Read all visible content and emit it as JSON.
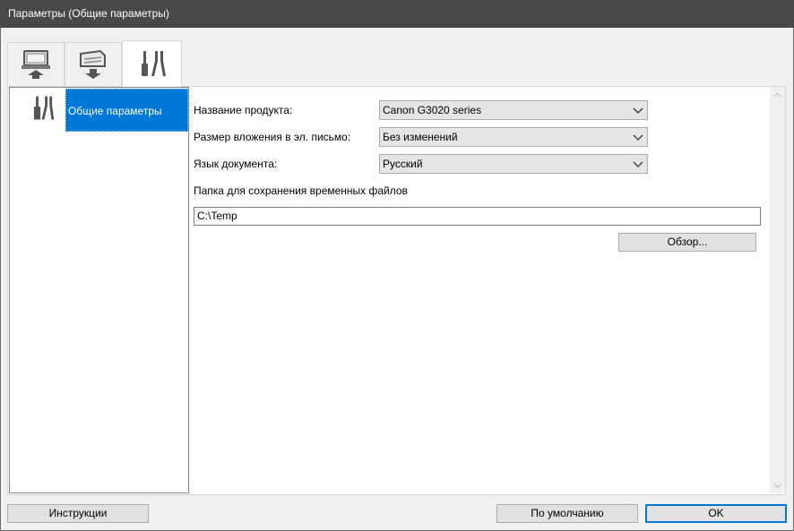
{
  "window": {
    "title": "Параметры (Общие параметры)"
  },
  "tabs": [
    {
      "icon": "computer-upload-icon",
      "active": false
    },
    {
      "icon": "scanner-download-icon",
      "active": false
    },
    {
      "icon": "tools-icon",
      "active": true
    }
  ],
  "nav": {
    "items": [
      {
        "icon": "tools-icon",
        "label": "Общие параметры",
        "selected": true
      }
    ]
  },
  "settings": {
    "product_name": {
      "label": "Название продукта:",
      "value": "Canon G3020 series"
    },
    "attachment_size": {
      "label": "Размер вложения в эл. письмо:",
      "value": "Без изменений"
    },
    "document_language": {
      "label": "Язык документа:",
      "value": "Русский"
    },
    "temp_folder": {
      "label": "Папка для сохранения временных файлов",
      "value": "C:\\Temp"
    },
    "browse_label": "Обзор..."
  },
  "footer": {
    "instructions_label": "Инструкции",
    "defaults_label": "По умолчанию",
    "ok_label": "OK"
  },
  "colors": {
    "titlebar": "#484848",
    "selection": "#0078d7",
    "background": "#f0f0f0"
  }
}
